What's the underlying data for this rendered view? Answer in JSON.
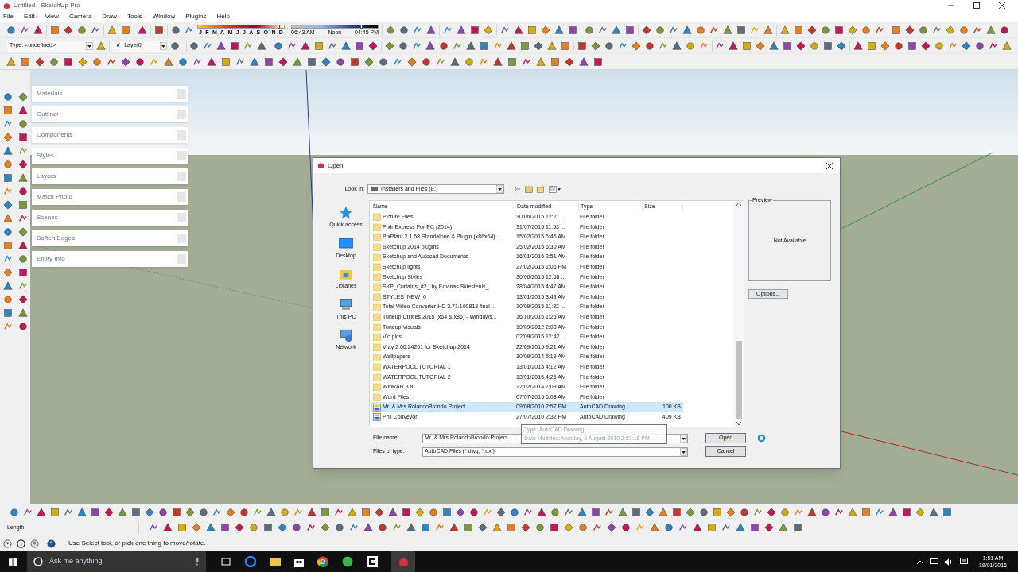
{
  "window": {
    "title": "Untitled - SketchUp Pro"
  },
  "menu": [
    "File",
    "Edit",
    "View",
    "Camera",
    "Draw",
    "Tools",
    "Window",
    "Plugins",
    "Help"
  ],
  "shadow": {
    "date_slider": {
      "level": 0.93
    },
    "time_slider": {
      "level": 0.8
    },
    "months": [
      "J",
      "F",
      "M",
      "A",
      "M",
      "J",
      "J",
      "A",
      "S",
      "O",
      "N",
      "D"
    ],
    "times": [
      "06:43 AM",
      "Noon",
      "04:45 PM"
    ]
  },
  "type_field": {
    "value": "Type: <undefined>"
  },
  "layer_field": {
    "check": "✔",
    "value": "Layer0"
  },
  "trays": [
    {
      "label": "Materials"
    },
    {
      "label": "Outliner"
    },
    {
      "label": "Components"
    },
    {
      "label": "Styles"
    },
    {
      "label": "Layers"
    },
    {
      "label": "Match Photo"
    },
    {
      "label": "Scenes"
    },
    {
      "label": "Soften Edges"
    },
    {
      "label": "Entity Info"
    }
  ],
  "dialog": {
    "title": "Open",
    "look_in_label": "Look in:",
    "look_in": "Installers and Files (E:)",
    "places": [
      {
        "label": "Quick access",
        "kind": "star"
      },
      {
        "label": "Desktop",
        "kind": "desktop"
      },
      {
        "label": "Libraries",
        "kind": "libraries"
      },
      {
        "label": "This PC",
        "kind": "pc"
      },
      {
        "label": "Network",
        "kind": "network"
      }
    ],
    "columns": [
      "Name",
      "Date modified",
      "Type",
      "Size"
    ],
    "rows": [
      {
        "name": "Picture Files",
        "date": "30/06/2015 12:21 ...",
        "type": "File folder",
        "kind": "folder",
        "selected": false
      },
      {
        "name": "Pixlr Express For PC (2014)",
        "date": "31/07/2015 11:53 ...",
        "type": "File folder",
        "kind": "folder",
        "selected": false
      },
      {
        "name": "PixPlant 2.1.68 Standalone & Plugin (x86x64)...",
        "date": "15/02/2015 6:46 AM",
        "type": "File folder",
        "kind": "folder",
        "selected": false
      },
      {
        "name": "Sketchup 2014 plugins",
        "date": "25/02/2015 6:30 AM",
        "type": "File folder",
        "kind": "folder",
        "selected": false
      },
      {
        "name": "Sketchup and Autocad Documents",
        "date": "16/01/2016 2:51 AM",
        "type": "File folder",
        "kind": "folder",
        "selected": false
      },
      {
        "name": "Sketchup lights",
        "date": "27/02/2015 1:06 PM",
        "type": "File folder",
        "kind": "folder",
        "selected": false
      },
      {
        "name": "Sketchup Styles",
        "date": "30/06/2015 12:58 ...",
        "type": "File folder",
        "kind": "folder",
        "selected": false
      },
      {
        "name": "SKP_Curtains_#2_ by Edvinas Skiestenis_",
        "date": "28/04/2015 4:47 AM",
        "type": "File folder",
        "kind": "folder",
        "selected": false
      },
      {
        "name": "STYLES_NEW_0",
        "date": "13/01/2015 3:43 AM",
        "type": "File folder",
        "kind": "folder",
        "selected": false
      },
      {
        "name": "Total Video Converter HD 3.71.100812 final ...",
        "date": "10/09/2015 11:32 ...",
        "type": "File folder",
        "kind": "folder",
        "selected": false
      },
      {
        "name": "Tuneup Utilities 2015 (x64 & x86) - Windows...",
        "date": "16/10/2015 1:26 AM",
        "type": "File folder",
        "kind": "folder",
        "selected": false
      },
      {
        "name": "Tuneup Visuals",
        "date": "19/09/2012 2:08 AM",
        "type": "File folder",
        "kind": "folder",
        "selected": false
      },
      {
        "name": "Vic pics",
        "date": "02/09/2015 12:42 ...",
        "type": "File folder",
        "kind": "folder",
        "selected": false
      },
      {
        "name": "Vray 2.00.24261 for Sketchup 2014",
        "date": "22/09/2015 9:21 AM",
        "type": "File folder",
        "kind": "folder",
        "selected": false
      },
      {
        "name": "Wallpapers",
        "date": "30/09/2014 5:19 AM",
        "type": "File folder",
        "kind": "folder",
        "selected": false
      },
      {
        "name": "WATERPOOL TUTORIAL 1",
        "date": "13/01/2015 4:12 AM",
        "type": "File folder",
        "kind": "folder",
        "selected": false
      },
      {
        "name": "WATERPOOL TUTORIAL 2",
        "date": "13/01/2015 4:26 AM",
        "type": "File folder",
        "kind": "folder",
        "selected": false
      },
      {
        "name": "WinRAR 3.8",
        "date": "22/02/2014 7:09 AM",
        "type": "File folder",
        "kind": "folder",
        "selected": false
      },
      {
        "name": "Word Files",
        "date": "07/07/2015 6:08 AM",
        "type": "File folder",
        "kind": "folder",
        "selected": false
      },
      {
        "name": "Mr. & Mrs.RolandoBrondo Project",
        "date": "09/08/2010 2:57 PM",
        "type": "AutoCAD Drawing",
        "size": "100 KB",
        "kind": "drawing",
        "selected": true
      },
      {
        "name": "Phil Conveyor",
        "date": "27/07/2010 2:32 PM",
        "type": "AutoCAD Drawing",
        "size": "409 KB",
        "kind": "drawing",
        "selected": false
      }
    ],
    "tooltip": [
      "Type: AutoCAD Drawing",
      "Date Modified: Monday, 9 August 2010 2:57:18 PM"
    ],
    "preview": {
      "title": "Preview",
      "text": "Not Available"
    },
    "options_button": "Options...",
    "file_name_label": "File name:",
    "file_name": "Mr. & Mrs.RolandoBrondo Project",
    "file_type_label": "Files of type:",
    "file_type": "AutoCAD Files (*.dwg, *.dxf)",
    "buttons": [
      "Open",
      "Cancel"
    ]
  },
  "measurement": {
    "label": "Length"
  },
  "status": {
    "text": "Use Select tool, or pick one thing to move/rotate."
  },
  "taskbar": {
    "search_placeholder": "Ask me anything",
    "time": "1:51 AM",
    "date": "19/01/2016"
  }
}
